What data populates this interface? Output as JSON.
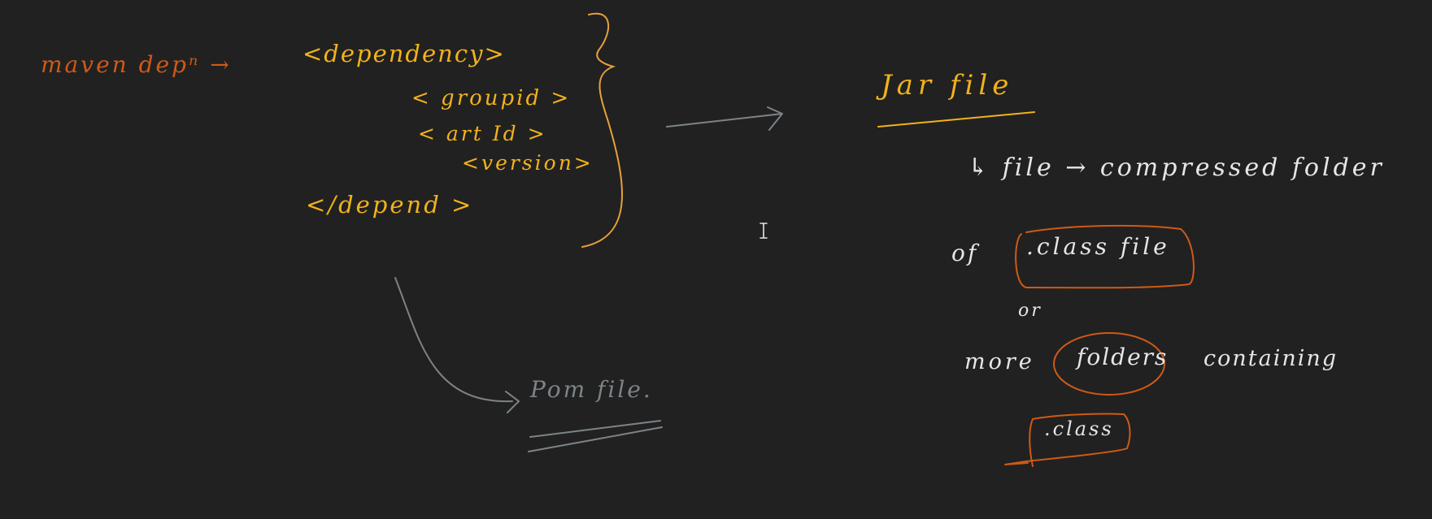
{
  "canvas": {
    "background": "#212121"
  },
  "colors": {
    "orange": "#cf5a16",
    "yellow": "#f2b21b",
    "grey": "#7c8488",
    "white": "#e6e6e6"
  },
  "notes": {
    "maven_dep": "maven depⁿ →",
    "dependency_open": "<dependency>",
    "group_id": "< groupid >",
    "artifact_id": "< art Id >",
    "version": "<version>",
    "dependency_close": "</depend >",
    "pom_file": "Pom file.",
    "jar_title": "Jar file",
    "jar_desc": "↳ file → compressed folder",
    "jar_of": "of",
    "class_file": ".class file",
    "or": "or",
    "more": "more",
    "folders": "folders",
    "containing": "containing",
    "class": ".class"
  },
  "icons": {
    "cursor": "text-cursor-icon"
  }
}
